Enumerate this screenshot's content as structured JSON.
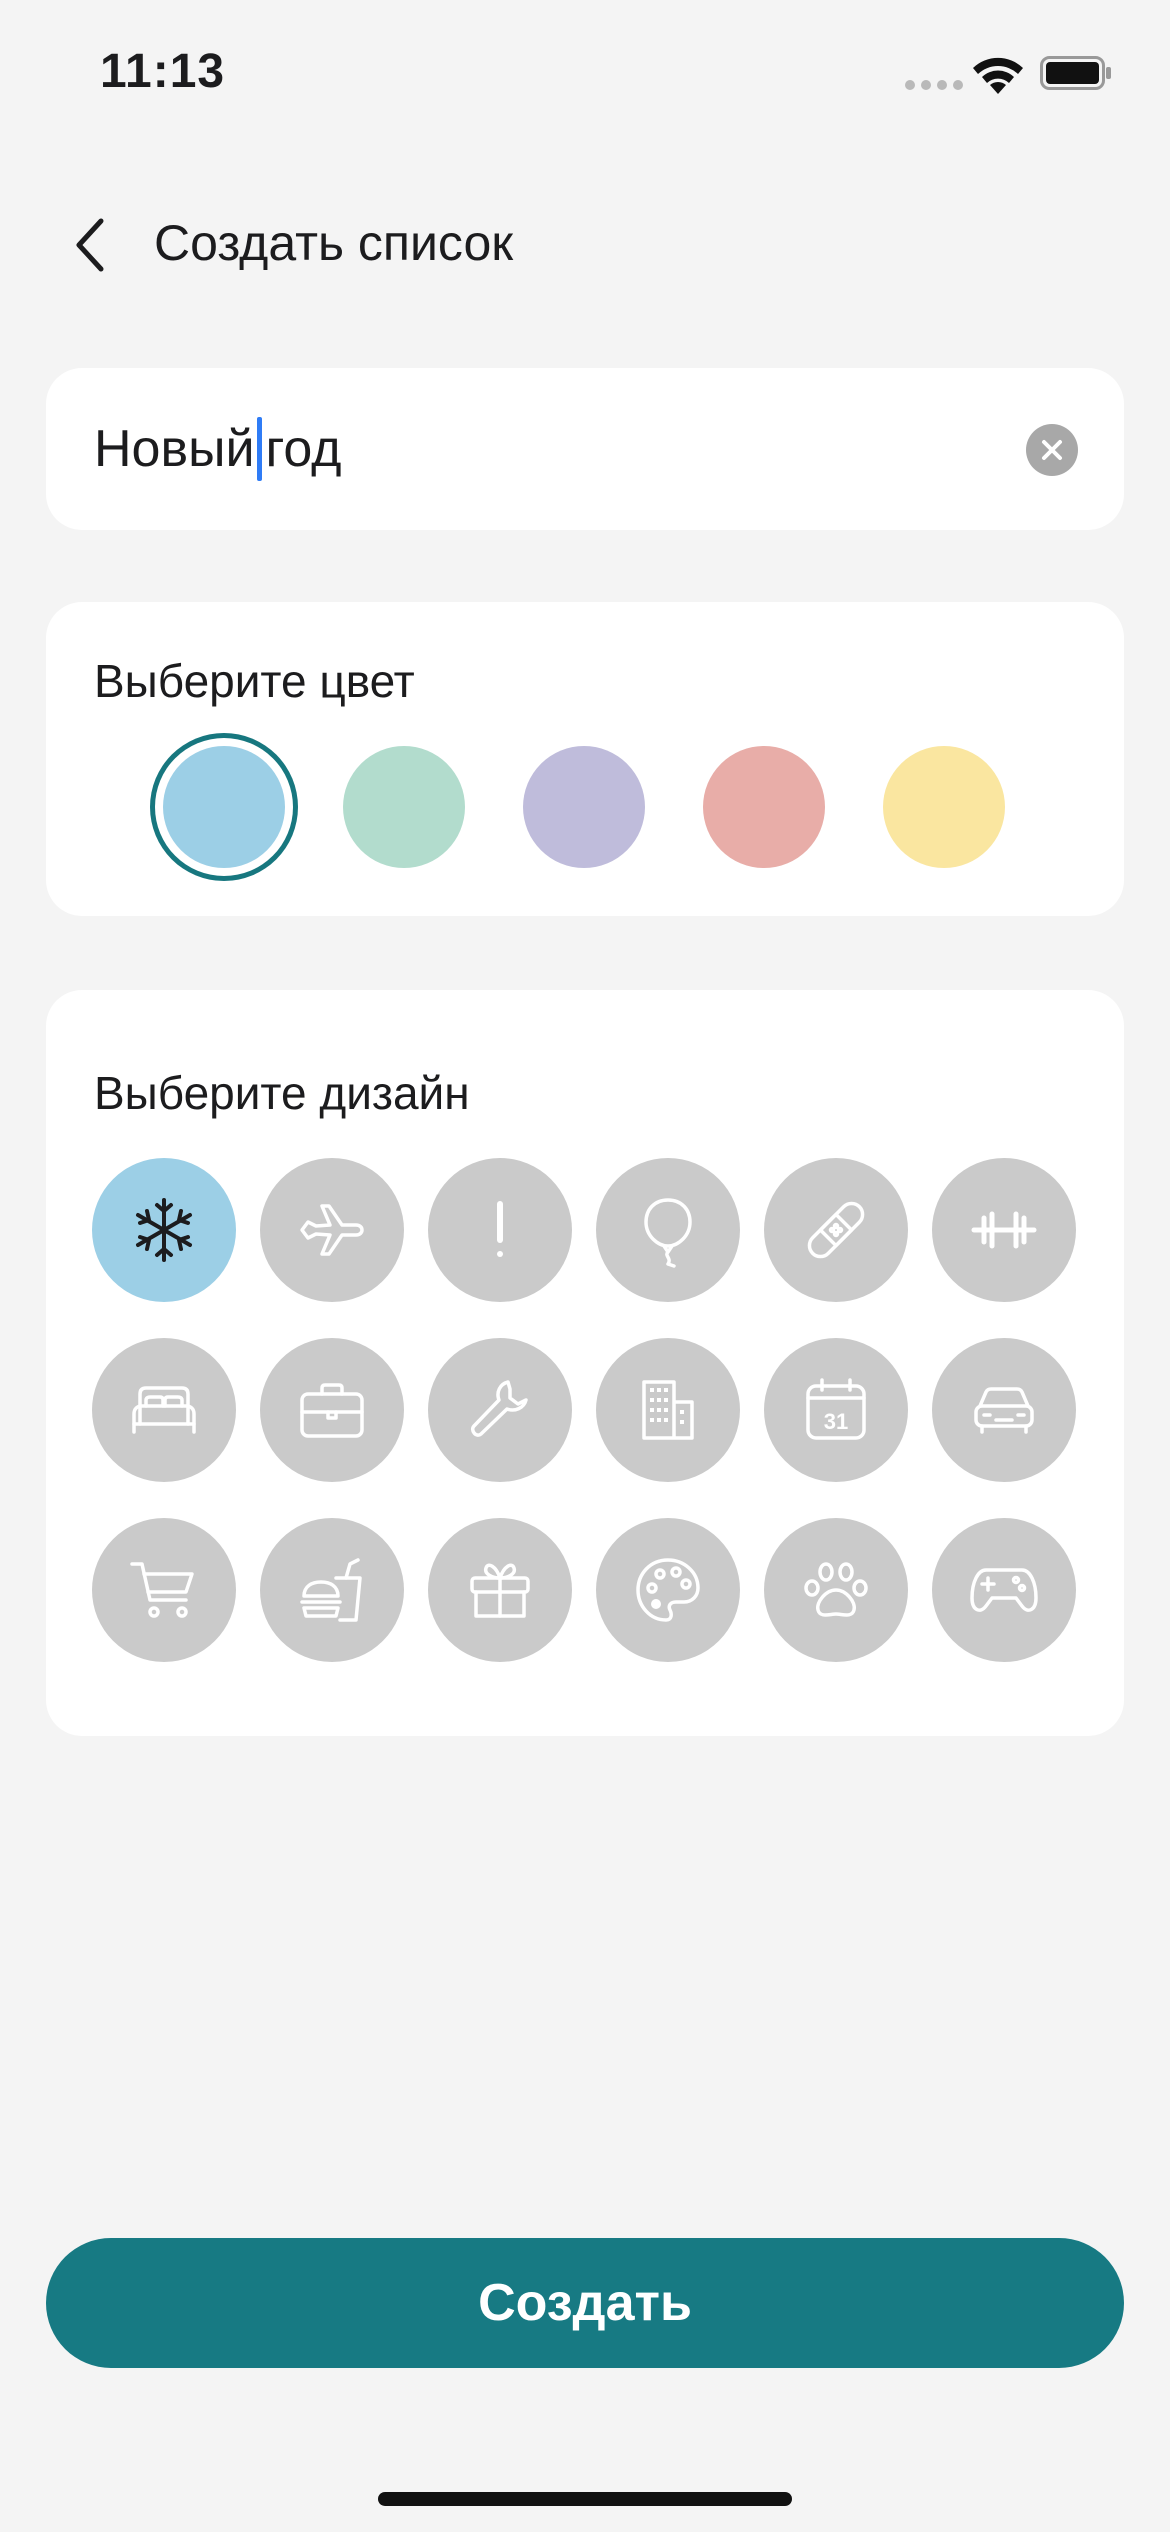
{
  "status_bar": {
    "time": "11:13"
  },
  "header": {
    "title": "Создать список"
  },
  "name_field": {
    "value_before_caret": "Новый",
    "value_after_caret": "год"
  },
  "color_section": {
    "label": "Выберите цвет",
    "selected_color": "#9ccfe6",
    "colors": [
      "#9ccfe6",
      "#b2dccd",
      "#bfbcdb",
      "#e8ada8",
      "#fae6a0"
    ]
  },
  "design_section": {
    "label": "Выберите дизайн",
    "selected_icon": "snowflake-icon",
    "icons": [
      "snowflake-icon",
      "airplane-icon",
      "exclamation-icon",
      "balloon-icon",
      "bandage-icon",
      "dumbbell-icon",
      "bed-icon",
      "briefcase-icon",
      "wrench-icon",
      "building-icon",
      "calendar-icon",
      "car-icon",
      "cart-icon",
      "fastfood-icon",
      "gift-icon",
      "palette-icon",
      "paw-icon",
      "gamepad-icon"
    ],
    "calendar_day": "31"
  },
  "actions": {
    "create_label": "Создать"
  },
  "colors": {
    "accent": "#177a83",
    "icon_inactive": "#ffffff",
    "icon_active": "#1c1c1e",
    "inactive_circle": "#cacaca"
  }
}
